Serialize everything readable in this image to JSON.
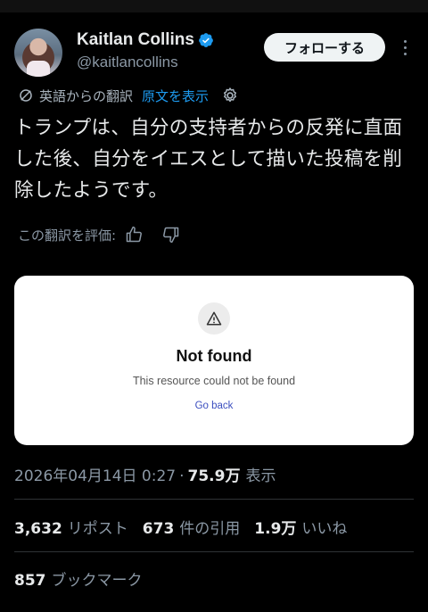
{
  "header": {
    "name": "Kaitlan Collins",
    "handle": "@kaitlancollins",
    "follow_label": "フォローする",
    "verified_color": "#1d9bf0"
  },
  "translation": {
    "label": "英語からの翻訳",
    "show_original": "原文を表示"
  },
  "tweet": {
    "text": "トランプは、自分の支持者からの反発に直面した後、自分をイエスとして描いた投稿を削除したようです。"
  },
  "rating": {
    "label": "この翻訳を評価:"
  },
  "card": {
    "title": "Not found",
    "subtitle": "This resource could not be found",
    "link": "Go back"
  },
  "meta": {
    "timestamp": "2026年04月14日 0:27",
    "separator": "·",
    "views": "75.9万",
    "views_label": "表示"
  },
  "stats": {
    "reposts_count": "3,632",
    "reposts_label": "リポスト",
    "quotes_count": "673",
    "quotes_label": "件の引用",
    "likes_count": "1.9万",
    "likes_label": "いいね",
    "bookmarks_count": "857",
    "bookmarks_label": "ブックマーク"
  }
}
